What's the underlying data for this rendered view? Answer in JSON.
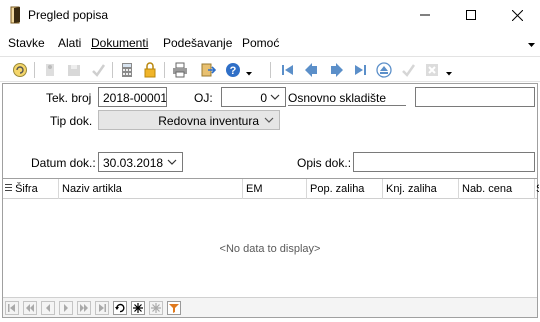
{
  "window": {
    "title": "Pregled popisa",
    "minimize_icon": "minimize-icon",
    "maximize_icon": "maximize-icon",
    "close_icon": "close-icon"
  },
  "menu": {
    "items": [
      "Stavke",
      "Alati",
      "Dokumenti",
      "Podešavanje",
      "Pomoć"
    ]
  },
  "toolbar": {
    "icons": [
      "refresh-icon",
      "edit-icon",
      "save-icon",
      "check-icon",
      "calculator-icon",
      "lock-icon",
      "print-icon",
      "export-icon",
      "help-icon",
      "first-icon",
      "previous-icon",
      "next-icon",
      "last-icon",
      "eject-icon",
      "confirm-icon",
      "cancel-icon"
    ]
  },
  "form": {
    "tek_broj_label": "Tek. broj",
    "tek_broj_value": "2018-00001",
    "oj_label": "OJ:",
    "oj_value": "0",
    "oj_name": "Osnovno skladište",
    "tip_dok_label": "Tip dok.",
    "tip_dok_value": "Redovna inventura",
    "datum_label": "Datum dok.:",
    "datum_value": "30.03.2018",
    "opis_label": "Opis dok.:",
    "opis_value": ""
  },
  "grid": {
    "columns": [
      "Šifra",
      "Naziv artikla",
      "EM",
      "Pop. zaliha",
      "Knj. zaliha",
      "Nab. cena",
      "S"
    ],
    "empty_text": "<No data to display>"
  },
  "colors": {
    "nav_blue": "#5b8fc9",
    "help_blue": "#2f6fc7",
    "filter_orange": "#e07a1f"
  }
}
